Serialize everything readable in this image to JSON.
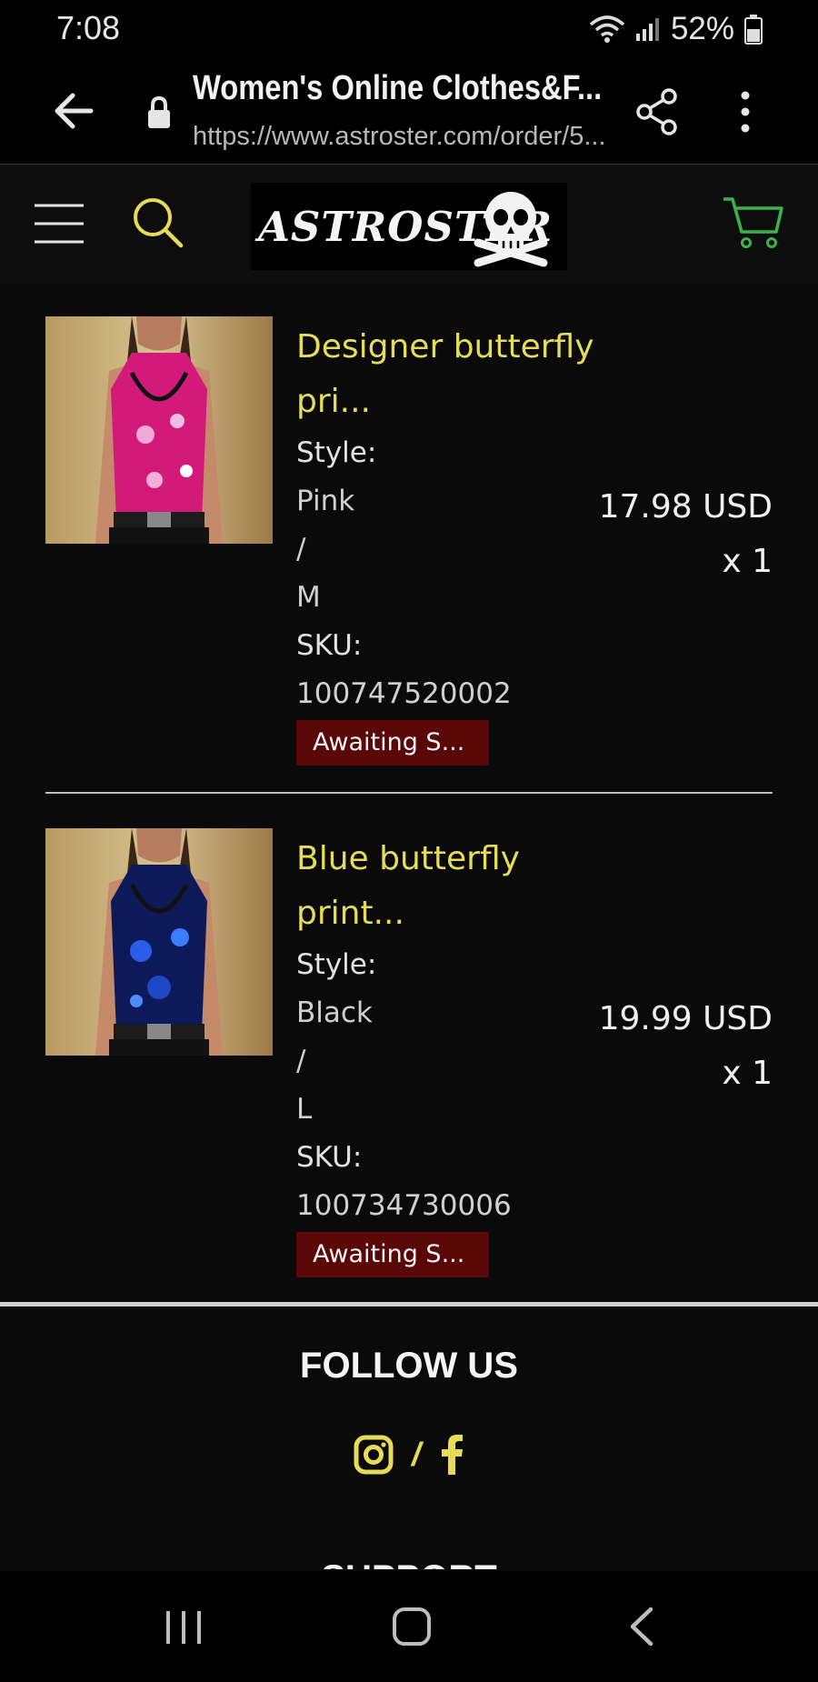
{
  "status_bar": {
    "time": "7:08",
    "battery": "52%"
  },
  "browser": {
    "title": "Women's Online Clothes&F...",
    "url": "https://www.astroster.com/order/5..."
  },
  "site": {
    "logo_text": "ASTROSTER"
  },
  "colors": {
    "accent_yellow": "#e7dc58",
    "badge_bg": "#5a0708",
    "cart_green": "#3bb34a"
  },
  "order_items": [
    {
      "name": "Designer butterfly pri...",
      "style_label": "Style:",
      "color": "Pink",
      "slash": "/",
      "size": "M",
      "sku_label": "SKU:",
      "sku": "100747520002",
      "status": "Awaiting S...",
      "price": "17.98 USD",
      "qty": "x 1"
    },
    {
      "name": "Blue butterfly print...",
      "style_label": "Style:",
      "color": "Black",
      "slash": "/",
      "size": "L",
      "sku_label": "SKU:",
      "sku": "100734730006",
      "status": "Awaiting S...",
      "price": "19.99 USD",
      "qty": "x 1"
    }
  ],
  "footer": {
    "follow_heading": "FOLLOW US",
    "social_separator": "/",
    "support_heading": "SUPPORT",
    "social_icons": [
      "instagram-icon",
      "facebook-icon"
    ]
  }
}
